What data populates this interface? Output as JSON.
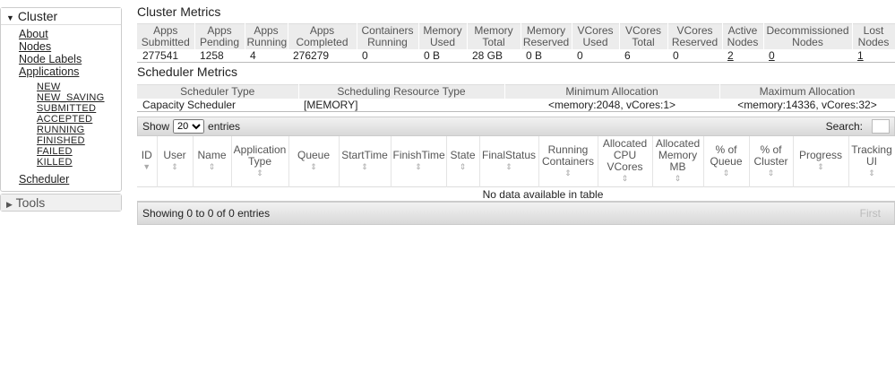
{
  "nav": {
    "cluster": "Cluster",
    "links": [
      "About",
      "Nodes",
      "Node Labels",
      "Applications"
    ],
    "states": [
      "NEW",
      "NEW_SAVING",
      "SUBMITTED",
      "ACCEPTED",
      "RUNNING",
      "FINISHED",
      "FAILED",
      "KILLED"
    ],
    "scheduler": "Scheduler",
    "tools": "Tools"
  },
  "cluster_metrics": {
    "title": "Cluster Metrics",
    "headers": [
      "Apps Submitted",
      "Apps Pending",
      "Apps Running",
      "Apps Completed",
      "Containers Running",
      "Memory Used",
      "Memory Total",
      "Memory Reserved",
      "VCores Used",
      "VCores Total",
      "VCores Reserved",
      "Active Nodes",
      "Decommissioned Nodes",
      "Lost Nodes"
    ],
    "values": [
      "277541",
      "1258",
      "4",
      "276279",
      "0",
      "0 B",
      "28 GB",
      "0 B",
      "0",
      "6",
      "0",
      "2",
      "0",
      "1"
    ]
  },
  "scheduler_metrics": {
    "title": "Scheduler Metrics",
    "headers": [
      "Scheduler Type",
      "Scheduling Resource Type",
      "Minimum Allocation",
      "Maximum Allocation"
    ],
    "values": [
      "Capacity Scheduler",
      "[MEMORY]",
      "<memory:2048, vCores:1>",
      "<memory:14336, vCores:32>"
    ]
  },
  "apps": {
    "show": "Show",
    "entries": "entries",
    "page_size": "20",
    "search": "Search:",
    "headers": [
      "ID",
      "User",
      "Name",
      "Application Type",
      "Queue",
      "StartTime",
      "FinishTime",
      "State",
      "FinalStatus",
      "Running Containers",
      "Allocated CPU VCores",
      "Allocated Memory MB",
      "% of Queue",
      "% of Cluster",
      "Progress",
      "Tracking UI"
    ],
    "empty": "No data available in table",
    "info": "Showing 0 to 0 of 0 entries",
    "first": "First"
  }
}
